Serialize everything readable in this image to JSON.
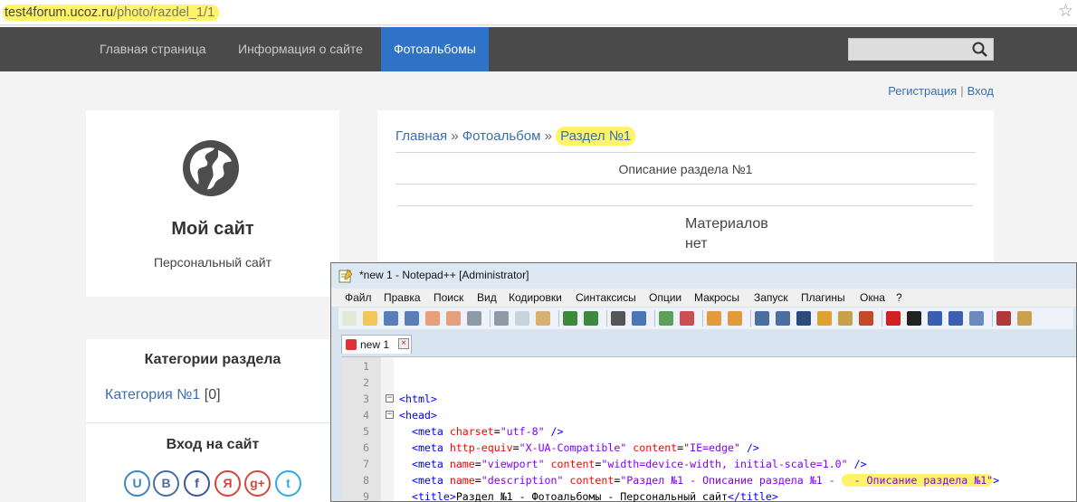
{
  "browser": {
    "url_host": "test4forum.ucoz.ru",
    "url_path": "/photo/razdel_1/1"
  },
  "nav": {
    "items": [
      {
        "label": "Главная страница"
      },
      {
        "label": "Информация о сайте"
      },
      {
        "label": "Фотоальбомы"
      }
    ],
    "active": "Фотоальбомы",
    "search_placeholder": ""
  },
  "auth": {
    "register": "Регистрация",
    "separator": "|",
    "login": "Вход"
  },
  "sidebar": {
    "site_name": "Мой сайт",
    "site_subtitle": "Персональный сайт",
    "categories_title": "Категории раздела",
    "category": {
      "label": "Категория №1",
      "count": "[0]"
    },
    "login_title": "Вход на сайт",
    "social": [
      {
        "icon": "ucoz-icon",
        "glyph": "U",
        "color": "#3d86c4"
      },
      {
        "icon": "vk-icon",
        "glyph": "B",
        "color": "#4a6ea0"
      },
      {
        "icon": "facebook-icon",
        "glyph": "f",
        "color": "#3b5998"
      },
      {
        "icon": "yandex-icon",
        "glyph": "Я",
        "color": "#d9433a"
      },
      {
        "icon": "googleplus-icon",
        "glyph": "g+",
        "color": "#d24b3e"
      },
      {
        "icon": "twitter-icon",
        "glyph": "t",
        "color": "#34a9dc"
      }
    ]
  },
  "main": {
    "breadcrumb": {
      "home": "Главная",
      "sep": " » ",
      "album": "Фотоальбом",
      "current": "Раздел №1"
    },
    "description": "Описание раздела №1",
    "no_materials": "Материалов нет"
  },
  "notepad": {
    "title": "*new  1 - Notepad++ [Administrator]",
    "menu": [
      "Файл",
      "Правка",
      "Поиск",
      "Вид",
      "Кодировки",
      "Синтаксисы",
      "Опции",
      "Макросы",
      "Запуск",
      "Плагины",
      "Окна",
      "?"
    ],
    "tab_label": "new  1",
    "lines": [
      {
        "n": "1",
        "fold": "",
        "parts": []
      },
      {
        "n": "2",
        "fold": "",
        "parts": []
      },
      {
        "n": "3",
        "fold": "−",
        "parts": [
          {
            "t": "<html>",
            "c": "tg"
          }
        ]
      },
      {
        "n": "4",
        "fold": "−",
        "parts": [
          {
            "t": "<head>",
            "c": "tg"
          }
        ]
      },
      {
        "n": "5",
        "fold": "",
        "parts": [
          {
            "t": "  <meta ",
            "c": "tg"
          },
          {
            "t": "charset",
            "c": "at"
          },
          {
            "t": "=",
            "c": "tx"
          },
          {
            "t": "\"utf-8\"",
            "c": "vl"
          },
          {
            "t": " />",
            "c": "tg"
          }
        ]
      },
      {
        "n": "6",
        "fold": "",
        "parts": [
          {
            "t": "  <meta ",
            "c": "tg"
          },
          {
            "t": "http-equiv",
            "c": "at"
          },
          {
            "t": "=",
            "c": "tx"
          },
          {
            "t": "\"X-UA-Compatible\"",
            "c": "vl"
          },
          {
            "t": " content",
            "c": "at"
          },
          {
            "t": "=",
            "c": "tx"
          },
          {
            "t": "\"IE=edge\"",
            "c": "vl"
          },
          {
            "t": " />",
            "c": "tg"
          }
        ]
      },
      {
        "n": "7",
        "fold": "",
        "parts": [
          {
            "t": "  <meta ",
            "c": "tg"
          },
          {
            "t": "name",
            "c": "at"
          },
          {
            "t": "=",
            "c": "tx"
          },
          {
            "t": "\"viewport\"",
            "c": "vl"
          },
          {
            "t": " content",
            "c": "at"
          },
          {
            "t": "=",
            "c": "tx"
          },
          {
            "t": "\"width=device-width, initial-scale=1.0\"",
            "c": "vl"
          },
          {
            "t": " />",
            "c": "tg"
          }
        ]
      },
      {
        "n": "8",
        "fold": "",
        "parts": [
          {
            "t": "  <meta ",
            "c": "tg"
          },
          {
            "t": "name",
            "c": "at"
          },
          {
            "t": "=",
            "c": "tx"
          },
          {
            "t": "\"description\"",
            "c": "vl"
          },
          {
            "t": " content",
            "c": "at"
          },
          {
            "t": "=",
            "c": "tx"
          },
          {
            "t": "\"Раздел №1 - Описание раздела №1 - ",
            "c": "vl"
          },
          {
            "t": "  - Описание раздела №1\"",
            "c": "vl chl"
          },
          {
            "t": ">",
            "c": "tg"
          }
        ]
      },
      {
        "n": "9",
        "fold": "",
        "parts": [
          {
            "t": "  <title>",
            "c": "tg"
          },
          {
            "t": "Раздел №1 - Фотоальбомы - Персональный сайт",
            "c": "tx"
          },
          {
            "t": "</title>",
            "c": "tg"
          }
        ]
      }
    ]
  }
}
